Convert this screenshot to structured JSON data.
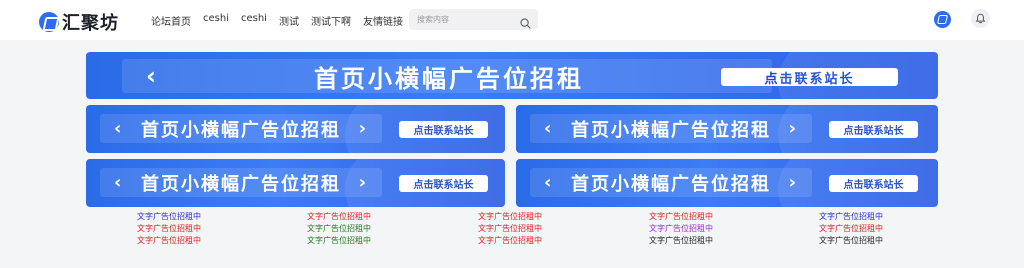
{
  "header": {
    "logo_text": "汇聚坊",
    "nav": [
      "论坛首页",
      "ceshi",
      "ceshi",
      "测试",
      "测试下啊",
      "友情链接"
    ],
    "search_placeholder": "搜索内容"
  },
  "banners": {
    "top": {
      "text": "首页小横幅广告位招租",
      "button": "点击联系站长",
      "left_arrow": "‹",
      "right_arrow": "›"
    },
    "small": [
      {
        "text": "首页小横幅广告位招租",
        "button": "点击联系站长",
        "left_arrow": "‹",
        "right_arrow": "›"
      },
      {
        "text": "首页小横幅广告位招租",
        "button": "点击联系站长",
        "left_arrow": "‹",
        "right_arrow": "›"
      },
      {
        "text": "首页小横幅广告位招租",
        "button": "点击联系站长",
        "left_arrow": "‹",
        "right_arrow": "›"
      },
      {
        "text": "首页小横幅广告位招租",
        "button": "点击联系站长",
        "left_arrow": "‹",
        "right_arrow": "›"
      }
    ]
  },
  "text_ads": {
    "columns": [
      [
        {
          "text": "文字广告位招租中",
          "color": "#2b2bd6"
        },
        {
          "text": "文字广告位招租中",
          "color": "#e02020"
        },
        {
          "text": "文字广告位招租中",
          "color": "#e02020"
        }
      ],
      [
        {
          "text": "文字广告位招租中",
          "color": "#e02020"
        },
        {
          "text": "文字广告位招租中",
          "color": "#1f7a1f"
        },
        {
          "text": "文字广告位招租中",
          "color": "#1f7a1f"
        }
      ],
      [
        {
          "text": "文字广告位招租中",
          "color": "#e02020"
        },
        {
          "text": "文字广告位招租中",
          "color": "#e02020"
        },
        {
          "text": "文字广告位招租中",
          "color": "#e02020"
        }
      ],
      [
        {
          "text": "文字广告位招租中",
          "color": "#e02020"
        },
        {
          "text": "文字广告位招租中",
          "color": "#9b2bd6"
        },
        {
          "text": "文字广告位招租中",
          "color": "#222222"
        }
      ],
      [
        {
          "text": "文字广告位招租中",
          "color": "#2b2bd6"
        },
        {
          "text": "文字广告位招租中",
          "color": "#e02020"
        },
        {
          "text": "文字广告位招租中",
          "color": "#222222"
        }
      ]
    ]
  },
  "icons": {
    "logo": "logo-icon",
    "search": "search-icon",
    "app": "app-icon",
    "bell": "bell-icon"
  },
  "colors": {
    "brand": "#2d6cf0",
    "banner": "#3c7cf5",
    "page_bg": "#f4f5f7"
  }
}
